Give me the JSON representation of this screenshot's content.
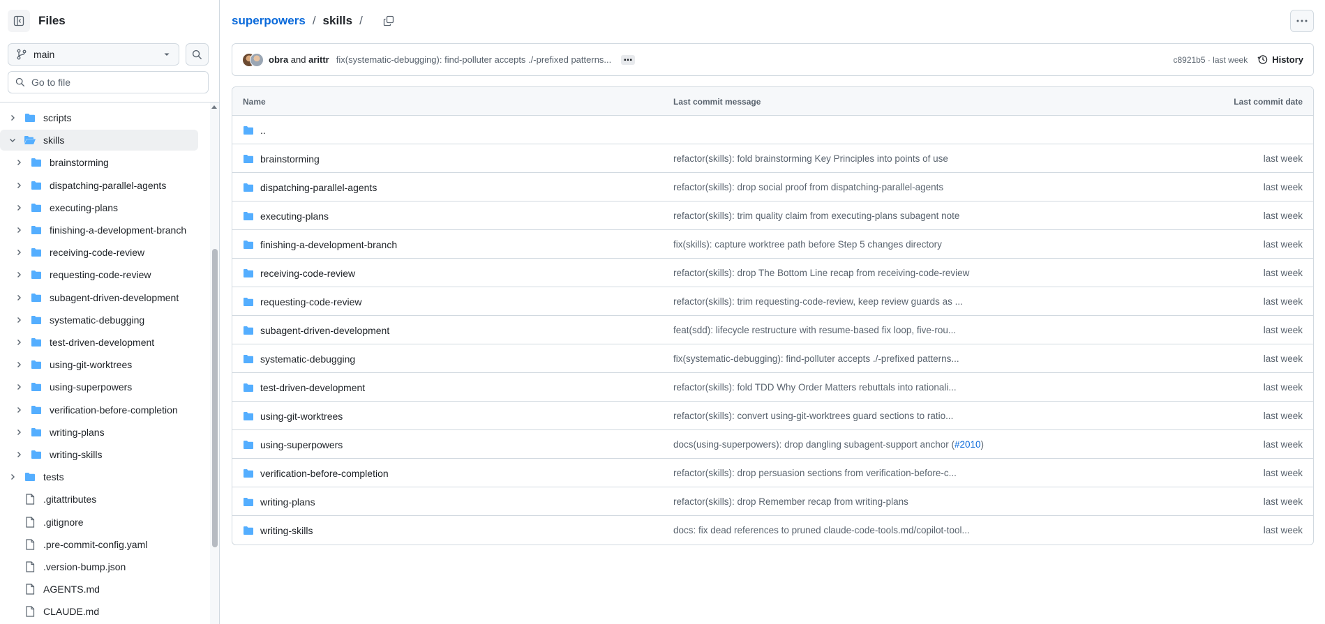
{
  "colors": {
    "accent": "#0969da",
    "folder": "#54aeff",
    "border": "#d1d9e0",
    "muted": "#59636e"
  },
  "sidebar": {
    "title": "Files",
    "branch": "main",
    "goto_placeholder": "Go to file",
    "tree": [
      {
        "label": "scripts",
        "type": "folder",
        "level": 0,
        "expanded": false
      },
      {
        "label": "skills",
        "type": "folder",
        "level": 0,
        "expanded": true,
        "selected": true
      },
      {
        "label": "brainstorming",
        "type": "folder",
        "level": 1,
        "expanded": false
      },
      {
        "label": "dispatching-parallel-agents",
        "type": "folder",
        "level": 1,
        "expanded": false
      },
      {
        "label": "executing-plans",
        "type": "folder",
        "level": 1,
        "expanded": false
      },
      {
        "label": "finishing-a-development-branch",
        "type": "folder",
        "level": 1,
        "expanded": false
      },
      {
        "label": "receiving-code-review",
        "type": "folder",
        "level": 1,
        "expanded": false
      },
      {
        "label": "requesting-code-review",
        "type": "folder",
        "level": 1,
        "expanded": false
      },
      {
        "label": "subagent-driven-development",
        "type": "folder",
        "level": 1,
        "expanded": false
      },
      {
        "label": "systematic-debugging",
        "type": "folder",
        "level": 1,
        "expanded": false
      },
      {
        "label": "test-driven-development",
        "type": "folder",
        "level": 1,
        "expanded": false
      },
      {
        "label": "using-git-worktrees",
        "type": "folder",
        "level": 1,
        "expanded": false
      },
      {
        "label": "using-superpowers",
        "type": "folder",
        "level": 1,
        "expanded": false
      },
      {
        "label": "verification-before-completion",
        "type": "folder",
        "level": 1,
        "expanded": false
      },
      {
        "label": "writing-plans",
        "type": "folder",
        "level": 1,
        "expanded": false
      },
      {
        "label": "writing-skills",
        "type": "folder",
        "level": 1,
        "expanded": false
      },
      {
        "label": "tests",
        "type": "folder",
        "level": 0,
        "expanded": false
      },
      {
        "label": ".gitattributes",
        "type": "file",
        "level": 0
      },
      {
        "label": ".gitignore",
        "type": "file",
        "level": 0
      },
      {
        "label": ".pre-commit-config.yaml",
        "type": "file",
        "level": 0
      },
      {
        "label": ".version-bump.json",
        "type": "file",
        "level": 0
      },
      {
        "label": "AGENTS.md",
        "type": "file",
        "level": 0
      },
      {
        "label": "CLAUDE.md",
        "type": "file",
        "level": 0
      }
    ]
  },
  "breadcrumb": {
    "repo": "superpowers",
    "sep": "/",
    "folder": "skills",
    "trail_sep": "/"
  },
  "commit": {
    "author1": "obra",
    "and": "and",
    "author2": "arittr",
    "message": "fix(systematic-debugging): find-polluter accepts ./-prefixed patterns...",
    "hash_time": "c8921b5 · last week",
    "history_label": "History"
  },
  "table": {
    "headers": {
      "name": "Name",
      "message": "Last commit message",
      "date": "Last commit date"
    },
    "parent": "..",
    "rows": [
      {
        "name": "brainstorming",
        "message": "refactor(skills): fold brainstorming Key Principles into points of use",
        "date": "last week"
      },
      {
        "name": "dispatching-parallel-agents",
        "message": "refactor(skills): drop social proof from dispatching-parallel-agents",
        "date": "last week"
      },
      {
        "name": "executing-plans",
        "message": "refactor(skills): trim quality claim from executing-plans subagent note",
        "date": "last week"
      },
      {
        "name": "finishing-a-development-branch",
        "message": "fix(skills): capture worktree path before Step 5 changes directory",
        "date": "last week"
      },
      {
        "name": "receiving-code-review",
        "message": "refactor(skills): drop The Bottom Line recap from receiving-code-review",
        "date": "last week"
      },
      {
        "name": "requesting-code-review",
        "message": "refactor(skills): trim requesting-code-review, keep review guards as ...",
        "date": "last week"
      },
      {
        "name": "subagent-driven-development",
        "message": "feat(sdd): lifecycle restructure with resume-based fix loop, five-rou...",
        "date": "last week"
      },
      {
        "name": "systematic-debugging",
        "message": "fix(systematic-debugging): find-polluter accepts ./-prefixed patterns...",
        "date": "last week"
      },
      {
        "name": "test-driven-development",
        "message": "refactor(skills): fold TDD Why Order Matters rebuttals into rationali...",
        "date": "last week"
      },
      {
        "name": "using-git-worktrees",
        "message": "refactor(skills): convert using-git-worktrees guard sections to ratio...",
        "date": "last week"
      },
      {
        "name": "using-superpowers",
        "message": "docs(using-superpowers): drop dangling subagent-support anchor (",
        "message_link": "#2010",
        "message_tail": ")",
        "date": "last week"
      },
      {
        "name": "verification-before-completion",
        "message": "refactor(skills): drop persuasion sections from verification-before-c...",
        "date": "last week"
      },
      {
        "name": "writing-plans",
        "message": "refactor(skills): drop Remember recap from writing-plans",
        "date": "last week"
      },
      {
        "name": "writing-skills",
        "message": "docs: fix dead references to pruned claude-code-tools.md/copilot-tool...",
        "date": "last week"
      }
    ]
  }
}
